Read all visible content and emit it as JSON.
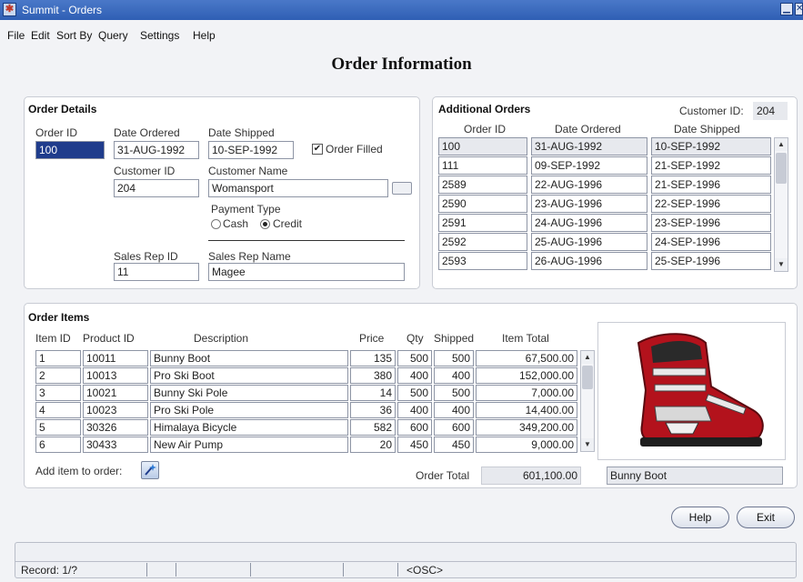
{
  "window": {
    "title": "Summit - Orders"
  },
  "menu": [
    "File",
    "Edit",
    "Sort By",
    "Query",
    "Settings",
    "Help"
  ],
  "form_title": "Order Information",
  "order_details": {
    "title": "Order Details",
    "order_id_label": "Order ID",
    "order_id": "100",
    "date_ordered_label": "Date Ordered",
    "date_ordered": "31-AUG-1992",
    "date_shipped_label": "Date Shipped",
    "date_shipped": "10-SEP-1992",
    "order_filled_label": "Order Filled",
    "order_filled_checked": true,
    "customer_id_label": "Customer ID",
    "customer_id": "204",
    "customer_name_label": "Customer Name",
    "customer_name": "Womansport",
    "payment_type_label": "Payment Type",
    "payment_cash": "Cash",
    "payment_credit": "Credit",
    "payment_selected": "Credit",
    "sales_rep_id_label": "Sales Rep ID",
    "sales_rep_id": "11",
    "sales_rep_name_label": "Sales Rep Name",
    "sales_rep_name": "Magee"
  },
  "additional_orders": {
    "title": "Additional Orders",
    "customer_id_label": "Customer ID:",
    "customer_id": "204",
    "columns": [
      "Order ID",
      "Date Ordered",
      "Date Shipped"
    ],
    "rows": [
      [
        "100",
        "31-AUG-1992",
        "10-SEP-1992"
      ],
      [
        "111",
        "09-SEP-1992",
        "21-SEP-1992"
      ],
      [
        "2589",
        "22-AUG-1996",
        "21-SEP-1996"
      ],
      [
        "2590",
        "23-AUG-1996",
        "22-SEP-1996"
      ],
      [
        "2591",
        "24-AUG-1996",
        "23-SEP-1996"
      ],
      [
        "2592",
        "25-AUG-1996",
        "24-SEP-1996"
      ],
      [
        "2593",
        "26-AUG-1996",
        "25-SEP-1996"
      ]
    ]
  },
  "order_items": {
    "title": "Order Items",
    "columns": [
      "Item ID",
      "Product ID",
      "Description",
      "Price",
      "Qty",
      "Shipped",
      "Item Total"
    ],
    "rows": [
      [
        "1",
        "10011",
        "Bunny Boot",
        "135",
        "500",
        "500",
        "67,500.00"
      ],
      [
        "2",
        "10013",
        "Pro Ski Boot",
        "380",
        "400",
        "400",
        "152,000.00"
      ],
      [
        "3",
        "10021",
        "Bunny Ski Pole",
        "14",
        "500",
        "500",
        "7,000.00"
      ],
      [
        "4",
        "10023",
        "Pro Ski Pole",
        "36",
        "400",
        "400",
        "14,400.00"
      ],
      [
        "5",
        "30326",
        "Himalaya Bicycle",
        "582",
        "600",
        "600",
        "349,200.00"
      ],
      [
        "6",
        "30433",
        "New Air Pump",
        "20",
        "450",
        "450",
        "9,000.00"
      ]
    ],
    "add_item_label": "Add item to order:",
    "order_total_label": "Order Total",
    "order_total": "601,100.00",
    "image_caption": "Bunny Boot"
  },
  "buttons": {
    "help": "Help",
    "exit": "Exit"
  },
  "status": {
    "record": "Record: 1/?",
    "osc": "<OSC>"
  },
  "colors": {
    "titlebar": "#2f5fb4",
    "selection": "#1f3c8c",
    "boot_red": "#b3121c"
  },
  "icons": [
    "app-icon",
    "minimize-icon",
    "close-icon",
    "wizard-icon",
    "scroll-up-icon",
    "scroll-down-icon"
  ]
}
